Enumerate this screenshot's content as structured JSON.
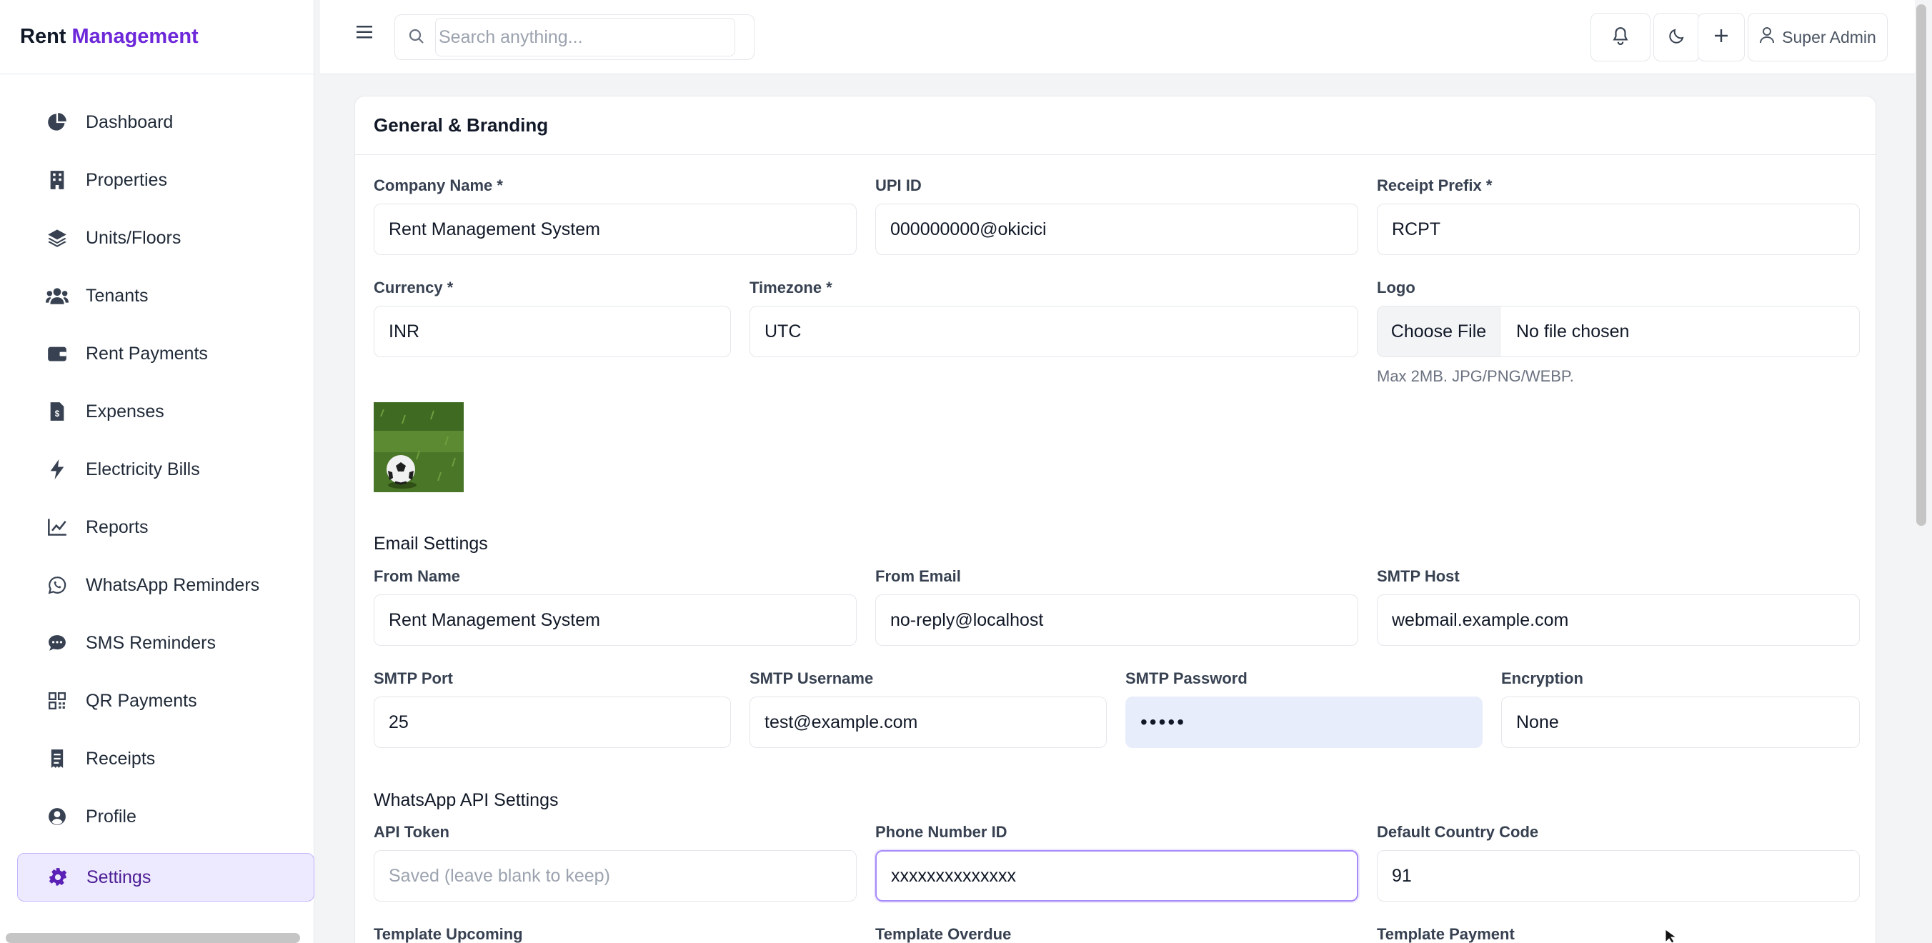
{
  "brand": {
    "part1": "Rent",
    "part2": "Management"
  },
  "sidebar": {
    "items": [
      {
        "label": "Dashboard",
        "icon": "dashboard-pie-icon"
      },
      {
        "label": "Properties",
        "icon": "building-icon"
      },
      {
        "label": "Units/Floors",
        "icon": "layers-icon"
      },
      {
        "label": "Tenants",
        "icon": "users-icon"
      },
      {
        "label": "Rent Payments",
        "icon": "wallet-icon"
      },
      {
        "label": "Expenses",
        "icon": "invoice-dollar-icon"
      },
      {
        "label": "Electricity Bills",
        "icon": "bolt-icon"
      },
      {
        "label": "Reports",
        "icon": "line-chart-icon"
      },
      {
        "label": "WhatsApp Reminders",
        "icon": "whatsapp-icon"
      },
      {
        "label": "SMS Reminders",
        "icon": "sms-icon"
      },
      {
        "label": "QR Payments",
        "icon": "qrcode-icon"
      },
      {
        "label": "Receipts",
        "icon": "receipt-icon"
      },
      {
        "label": "Profile",
        "icon": "user-circle-icon"
      },
      {
        "label": "Settings",
        "icon": "gear-icon"
      }
    ],
    "active": "Settings"
  },
  "topbar": {
    "search_placeholder": "Search anything...",
    "user_label": "Super Admin"
  },
  "card": {
    "title": "General & Branding",
    "general": {
      "company_name": {
        "label": "Company Name *",
        "value": "Rent Management System"
      },
      "upi_id": {
        "label": "UPI ID",
        "value": "000000000@okicici"
      },
      "receipt_prefix": {
        "label": "Receipt Prefix *",
        "value": "RCPT"
      },
      "currency": {
        "label": "Currency *",
        "value": "INR"
      },
      "timezone": {
        "label": "Timezone *",
        "value": "UTC"
      },
      "logo": {
        "label": "Logo",
        "button": "Choose File",
        "status": "No file chosen",
        "hint": "Max 2MB. JPG/PNG/WEBP."
      }
    },
    "email": {
      "title": "Email Settings",
      "from_name": {
        "label": "From Name",
        "value": "Rent Management System"
      },
      "from_email": {
        "label": "From Email",
        "value": "no-reply@localhost"
      },
      "smtp_host": {
        "label": "SMTP Host",
        "value": "webmail.example.com"
      },
      "smtp_port": {
        "label": "SMTP Port",
        "value": "25"
      },
      "smtp_username": {
        "label": "SMTP Username",
        "value": "test@example.com"
      },
      "smtp_password": {
        "label": "SMTP Password",
        "value": "•••••"
      },
      "encryption": {
        "label": "Encryption",
        "value": "None"
      }
    },
    "whatsapp": {
      "title": "WhatsApp API Settings",
      "api_token": {
        "label": "API Token",
        "placeholder": "Saved (leave blank to keep)"
      },
      "phone_number_id": {
        "label": "Phone Number ID",
        "value": "xxxxxxxxxxxxxx"
      },
      "country_code": {
        "label": "Default Country Code",
        "value": "91"
      },
      "template_upcoming": {
        "label": "Template Upcoming"
      },
      "template_overdue": {
        "label": "Template Overdue"
      },
      "template_payment": {
        "label": "Template Payment"
      }
    }
  }
}
